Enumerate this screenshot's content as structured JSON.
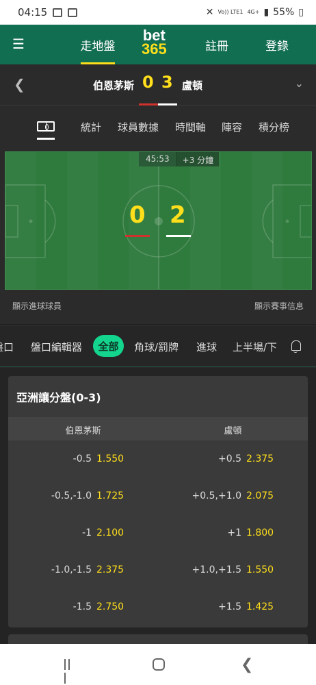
{
  "status_bar": {
    "time": "04:15",
    "network": "4G+",
    "network_sub": "Vo)) LTE1",
    "battery": "55%"
  },
  "header": {
    "live_label": "走地盤",
    "logo_top": "bet",
    "logo_bottom": "365",
    "register_label": "註冊",
    "login_label": "登錄"
  },
  "match": {
    "home_team": "伯恩茅斯",
    "away_team": "盧頓",
    "home_score": "0",
    "away_score": "3",
    "home_kit_color": "#d0312d",
    "away_kit_color": "#ffffff"
  },
  "stat_tabs": [
    "統計",
    "球員數據",
    "時間軸",
    "陣容",
    "積分榜"
  ],
  "pitch": {
    "clock": "45:53",
    "added_time": "+3 分鐘",
    "home_score": "0",
    "away_score": "2",
    "show_scorers": "顯示進球球員",
    "show_match_info": "顯示賽事信息"
  },
  "market_tabs": {
    "items": [
      "盤口",
      "盤口編輯器",
      "角球/罰牌",
      "進球",
      "上半場/下"
    ],
    "selected": "全部"
  },
  "market": {
    "title": "亞洲讓分盤(0-3)",
    "home_header": "伯恩茅斯",
    "away_header": "盧頓",
    "rows": [
      {
        "home_line": "-0.5",
        "home_price": "1.550",
        "away_line": "+0.5",
        "away_price": "2.375"
      },
      {
        "home_line": "-0.5,-1.0",
        "home_price": "1.725",
        "away_line": "+0.5,+1.0",
        "away_price": "2.075"
      },
      {
        "home_line": "-1",
        "home_price": "2.100",
        "away_line": "+1",
        "away_price": "1.800"
      },
      {
        "home_line": "-1.0,-1.5",
        "home_price": "2.375",
        "away_line": "+1.0,+1.5",
        "away_price": "1.550"
      },
      {
        "home_line": "-1.5",
        "home_price": "2.750",
        "away_line": "+1.5",
        "away_price": "1.425"
      }
    ]
  },
  "colors": {
    "brand_green": "#126e51",
    "accent_yellow": "#ffdf1b",
    "pill_green": "#14d58d",
    "pitch_green": "#2f7a3d"
  }
}
